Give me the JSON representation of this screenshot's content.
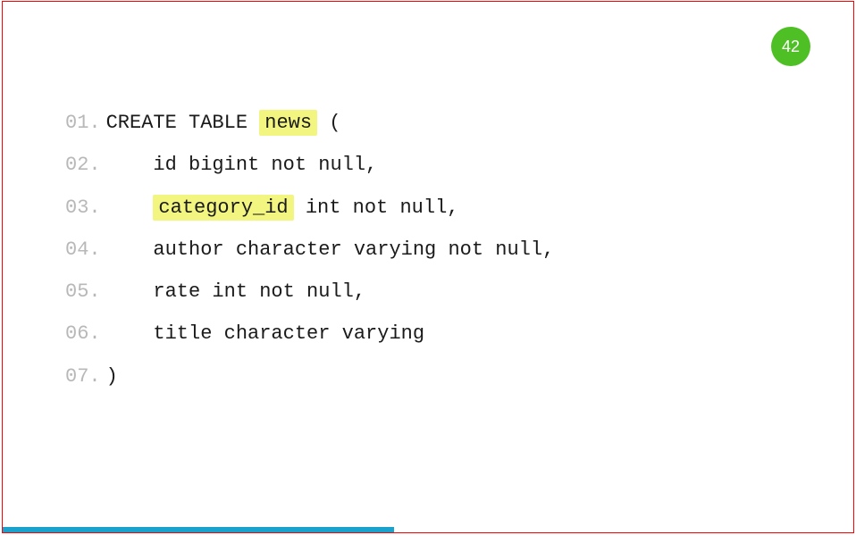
{
  "slide": {
    "number": "42",
    "progress_percent": 46
  },
  "code": {
    "lines": [
      {
        "num": "01.",
        "prefix": "CREATE TABLE ",
        "highlight": "news",
        "suffix": " ("
      },
      {
        "num": "02.",
        "indent": true,
        "text": "id bigint not null,"
      },
      {
        "num": "03.",
        "indent": true,
        "prefix": "",
        "highlight": "category_id",
        "suffix": " int not null,"
      },
      {
        "num": "04.",
        "indent": true,
        "text": "author character varying not null,"
      },
      {
        "num": "05.",
        "indent": true,
        "text": "rate int not null,"
      },
      {
        "num": "06.",
        "indent": true,
        "text": "title character varying"
      },
      {
        "num": "07.",
        "text": ")"
      }
    ]
  }
}
